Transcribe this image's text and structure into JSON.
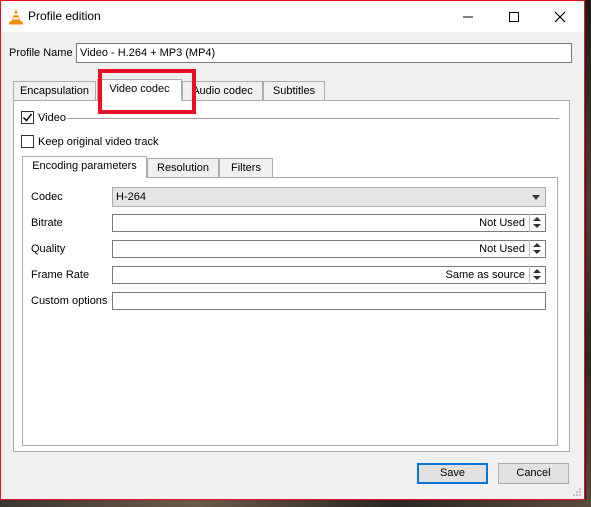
{
  "window": {
    "title": "Profile edition",
    "icon": "vlc-cone-icon"
  },
  "profile": {
    "label": "Profile Name",
    "value": "Video - H.264 + MP3 (MP4)"
  },
  "tabs": [
    {
      "label": "Encapsulation",
      "active": false
    },
    {
      "label": "Video codec",
      "active": true
    },
    {
      "label": "Audio codec",
      "active": false
    },
    {
      "label": "Subtitles",
      "active": false
    }
  ],
  "video": {
    "enable_label": "Video",
    "enable_checked": true,
    "keep_original_label": "Keep original video track",
    "keep_original_checked": false
  },
  "inner_tabs": [
    {
      "label": "Encoding parameters",
      "active": true
    },
    {
      "label": "Resolution",
      "active": false
    },
    {
      "label": "Filters",
      "active": false
    }
  ],
  "params": {
    "codec_label": "Codec",
    "codec_value": "H-264",
    "bitrate_label": "Bitrate",
    "bitrate_value": "Not Used",
    "quality_label": "Quality",
    "quality_value": "Not Used",
    "framerate_label": "Frame Rate",
    "framerate_value": "Same as source",
    "custom_label": "Custom options",
    "custom_value": ""
  },
  "buttons": {
    "save": "Save",
    "cancel": "Cancel"
  },
  "colors": {
    "highlight": "#e81123",
    "default_button_border": "#0078d7"
  }
}
